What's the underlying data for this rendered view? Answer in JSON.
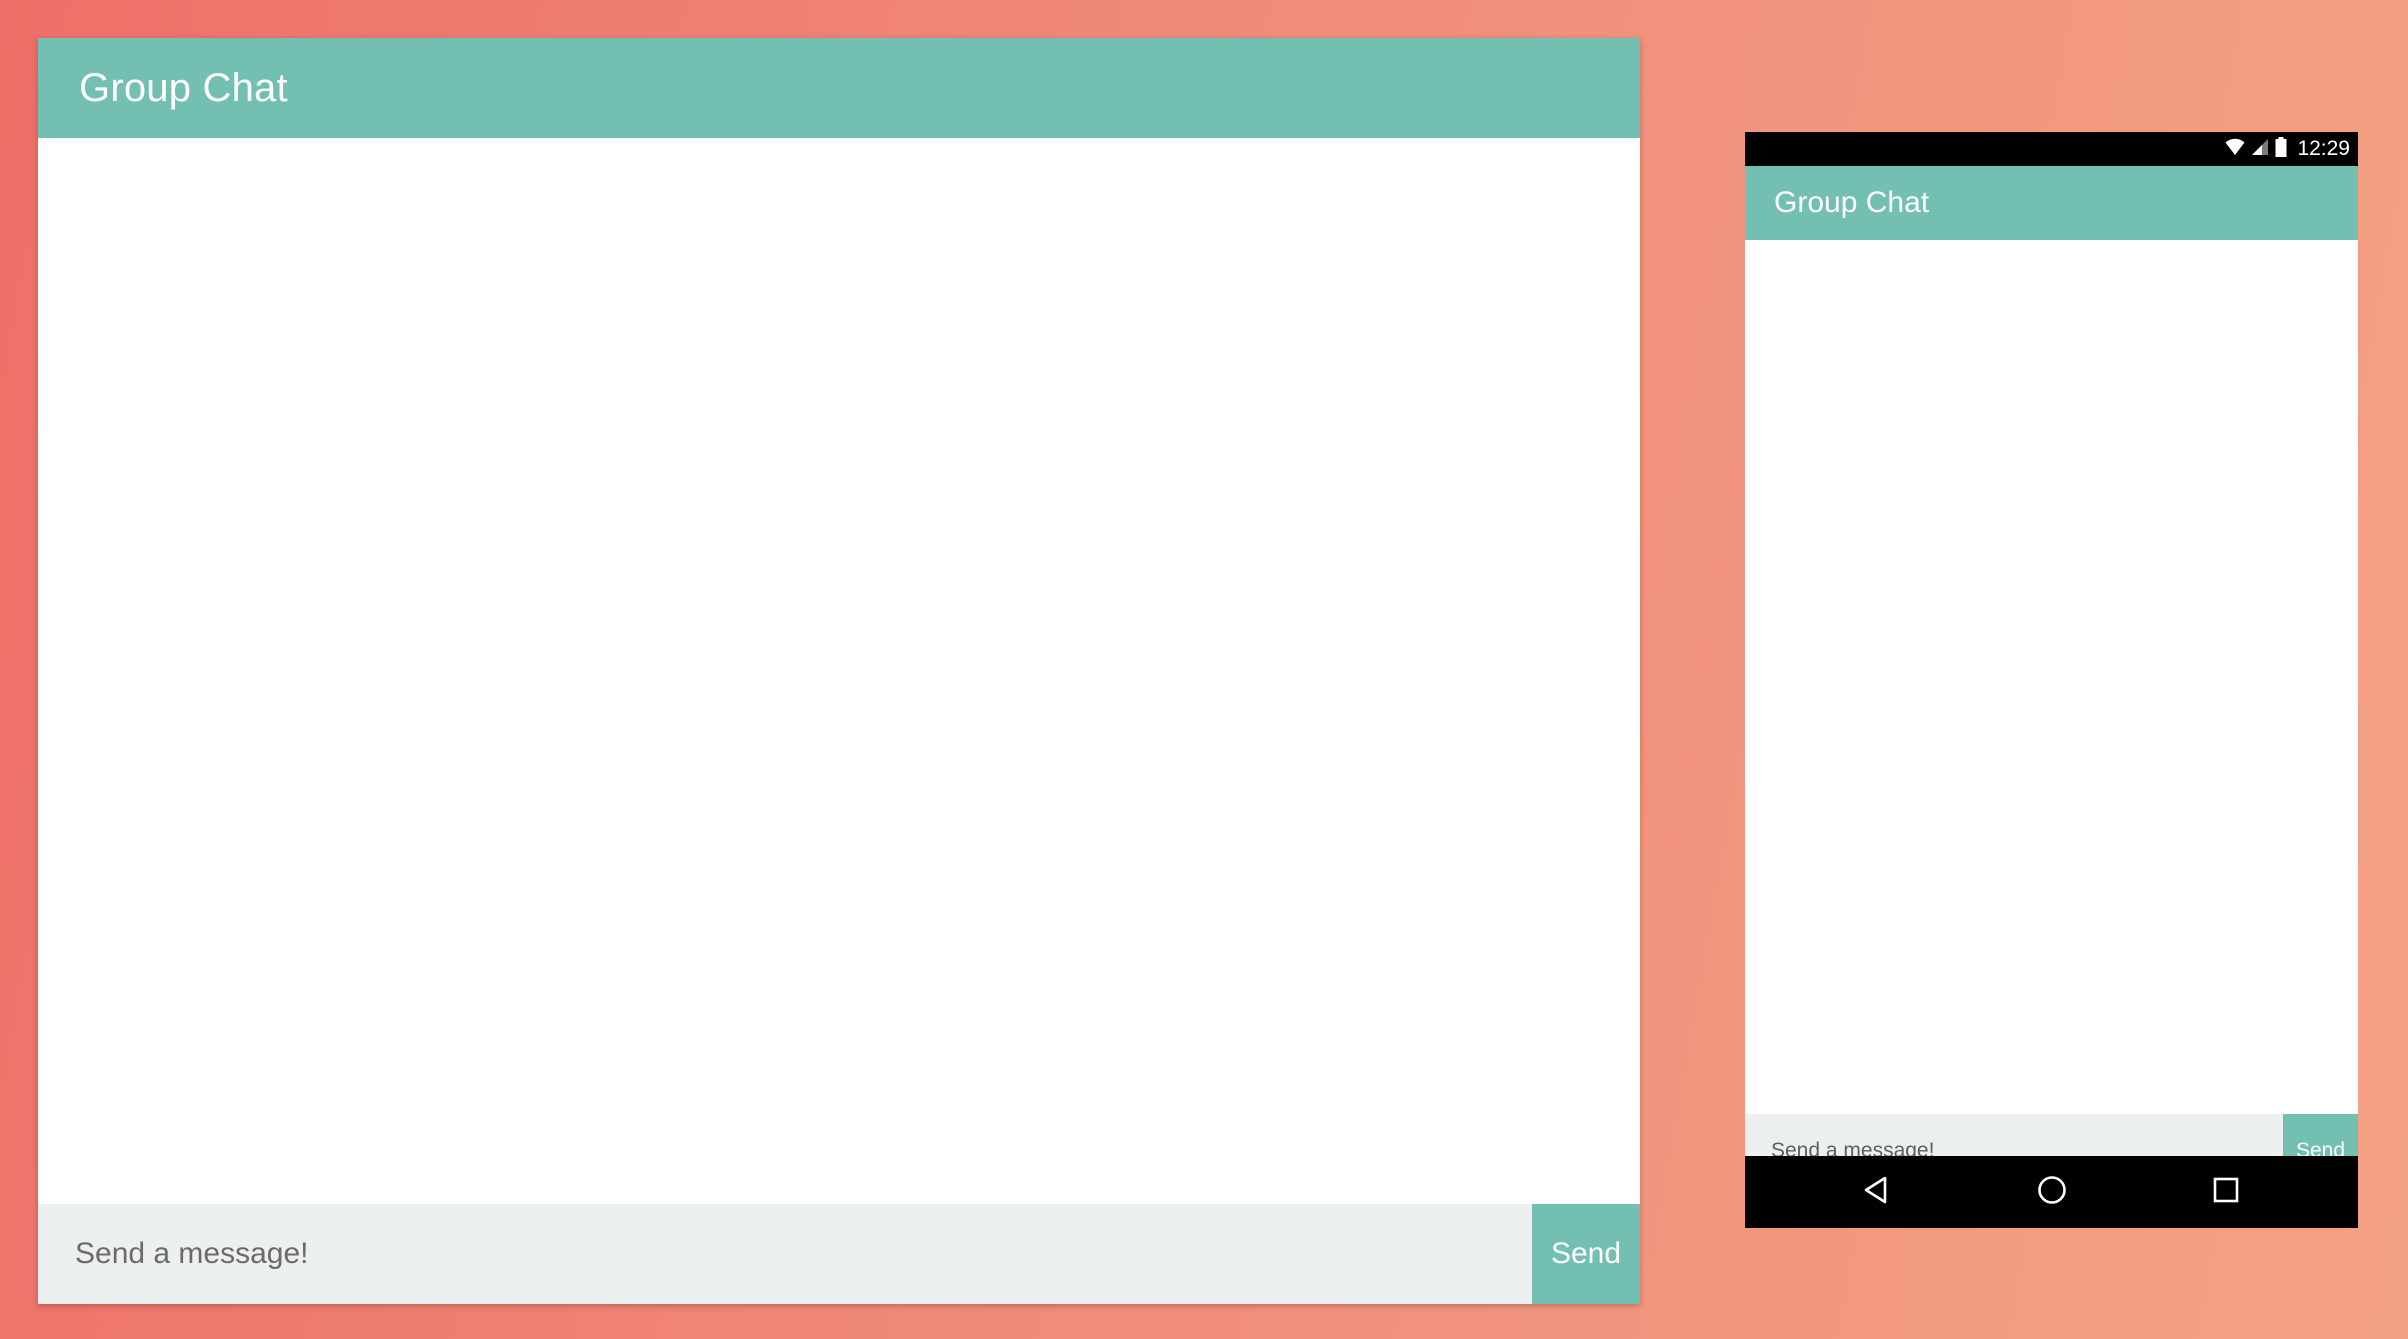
{
  "desktop": {
    "header": {
      "title": "Group Chat"
    },
    "composer": {
      "placeholder": "Send a message!",
      "value": "",
      "send_label": "Send"
    }
  },
  "mobile": {
    "status_bar": {
      "time": "12:29",
      "icons": [
        "wifi-icon",
        "cell-signal-icon",
        "battery-icon"
      ]
    },
    "header": {
      "title": "Group Chat"
    },
    "composer": {
      "placeholder": "Send a message!",
      "value": "",
      "send_label": "Send"
    },
    "nav_bar": {
      "buttons": [
        "back-icon",
        "home-icon",
        "recents-icon"
      ]
    }
  },
  "colors": {
    "accent": "#73bfb1",
    "composer_bg": "#ecf0f1",
    "background_start": "#ee6f69",
    "background_end": "#f3a283"
  }
}
